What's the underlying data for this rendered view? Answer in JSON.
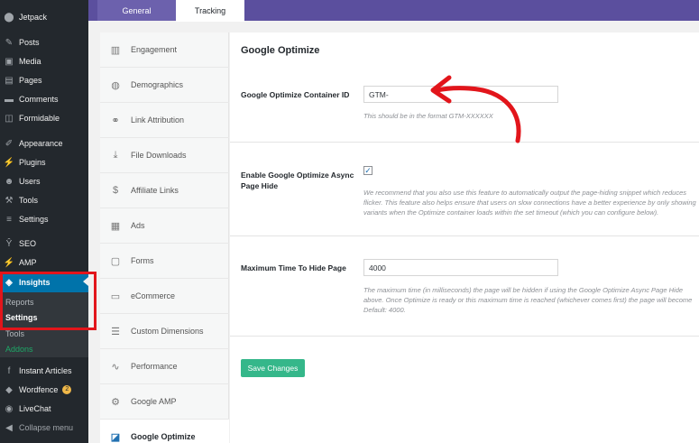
{
  "wp_menu": [
    {
      "label": "Jetpack",
      "icon": "jetpack-icon",
      "glyph": "⬤"
    },
    {
      "label": "Posts",
      "icon": "pin-icon",
      "glyph": "✎"
    },
    {
      "label": "Media",
      "icon": "media-icon",
      "glyph": "▣"
    },
    {
      "label": "Pages",
      "icon": "pages-icon",
      "glyph": "▤"
    },
    {
      "label": "Comments",
      "icon": "comment-icon",
      "glyph": "▬"
    },
    {
      "label": "Formidable",
      "icon": "formidable-icon",
      "glyph": "◫"
    },
    {
      "label": "Appearance",
      "icon": "brush-icon",
      "glyph": "✐"
    },
    {
      "label": "Plugins",
      "icon": "plugin-icon",
      "glyph": "⚡"
    },
    {
      "label": "Users",
      "icon": "users-icon",
      "glyph": "☻"
    },
    {
      "label": "Tools",
      "icon": "wrench-icon",
      "glyph": "⚒"
    },
    {
      "label": "Settings",
      "icon": "sliders-icon",
      "glyph": "≡"
    },
    {
      "label": "SEO",
      "icon": "seo-icon",
      "glyph": "Ŷ"
    },
    {
      "label": "AMP",
      "icon": "amp-icon",
      "glyph": "⚡"
    },
    {
      "label": "Insights",
      "icon": "insights-icon",
      "glyph": "◈"
    },
    {
      "label": "Instant Articles",
      "icon": "facebook-icon",
      "glyph": "f"
    },
    {
      "label": "Wordfence",
      "icon": "wordfence-icon",
      "glyph": "◆",
      "badge": "2"
    },
    {
      "label": "LiveChat",
      "icon": "livechat-icon",
      "glyph": "◉"
    },
    {
      "label": "Collapse menu",
      "icon": "collapse-icon",
      "glyph": "◀"
    }
  ],
  "wp_submenu": [
    "Reports",
    "Settings",
    "Tools",
    "Addons"
  ],
  "tabs": {
    "general": "General",
    "tracking": "Tracking"
  },
  "left_nav": [
    {
      "label": "Engagement",
      "icon": "engagement-icon",
      "glyph": "▥"
    },
    {
      "label": "Demographics",
      "icon": "globe-icon",
      "glyph": "◍"
    },
    {
      "label": "Link Attribution",
      "icon": "link-icon",
      "glyph": "⚭"
    },
    {
      "label": "File Downloads",
      "icon": "download-icon",
      "glyph": "⤓"
    },
    {
      "label": "Affiliate Links",
      "icon": "dollar-icon",
      "glyph": "$"
    },
    {
      "label": "Ads",
      "icon": "ads-icon",
      "glyph": "▦"
    },
    {
      "label": "Forms",
      "icon": "forms-icon",
      "glyph": "▢"
    },
    {
      "label": "eCommerce",
      "icon": "ecommerce-icon",
      "glyph": "▭"
    },
    {
      "label": "Custom Dimensions",
      "icon": "dimensions-icon",
      "glyph": "☰"
    },
    {
      "label": "Performance",
      "icon": "performance-icon",
      "glyph": "∿"
    },
    {
      "label": "Google AMP",
      "icon": "amp-icon",
      "glyph": "⚙"
    },
    {
      "label": "Google Optimize",
      "icon": "optimize-icon",
      "glyph": "◪"
    }
  ],
  "content": {
    "title": "Google Optimize",
    "container_label": "Google Optimize Container ID",
    "container_value": "GTM-",
    "container_help": "This should be in the format GTM-XXXXXX",
    "async_label": "Enable Google Optimize Async Page Hide",
    "async_checked": "✓",
    "async_help_1": "We recommend that you also use this feature to automatically output the page-hiding snippet which reduces",
    "async_help_2": "flicker. This feature also helps ensure that users on slow connections have a better experience by only showing",
    "async_help_3": "variants when the Optimize container loads within the set timeout (which you can configure below).",
    "maxtime_label": "Maximum Time To Hide Page",
    "maxtime_value": "4000",
    "maxtime_help_1": "The maximum time (in milliseconds) the page will be hidden if using the Google Optimize Async Page Hide",
    "maxtime_help_2": "above. Once Optimize is ready or this maximum time is reached (whichever comes first) the page will become",
    "maxtime_help_3": "Default: 4000.",
    "save_label": "Save Changes"
  },
  "colors": {
    "accent": "#5b4f9e",
    "wp_active": "#0073aa",
    "save": "#35b78a",
    "annotation": "#e2151b"
  }
}
